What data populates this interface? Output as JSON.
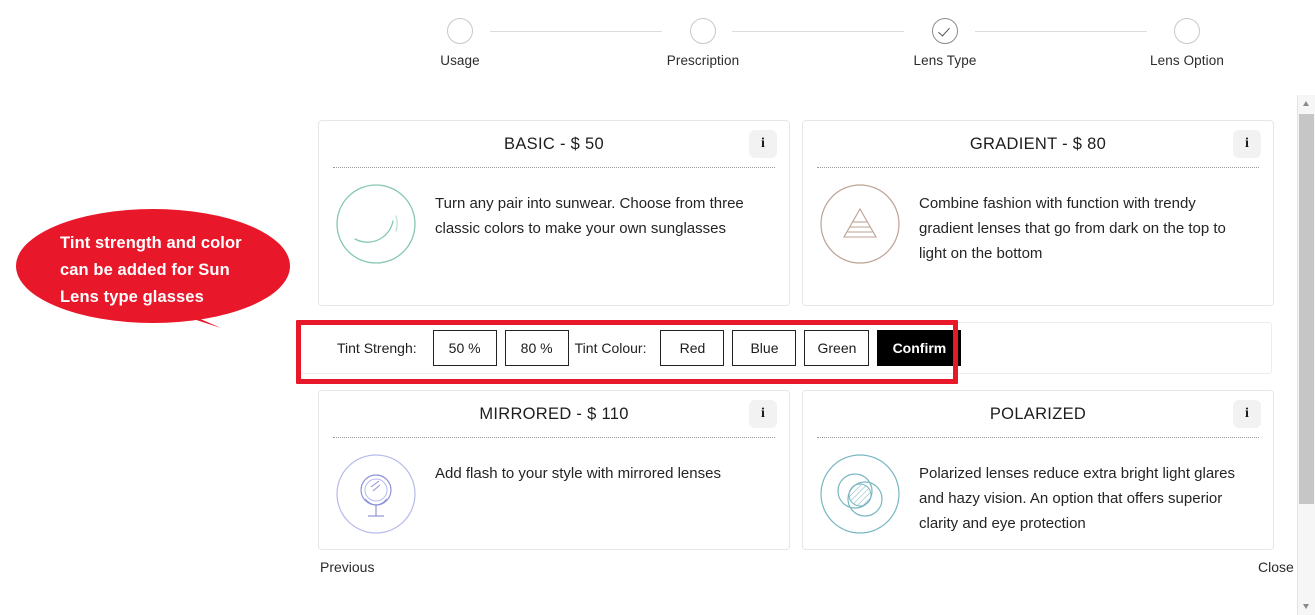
{
  "stepper": {
    "steps": [
      {
        "label": "Usage",
        "state": "pending"
      },
      {
        "label": "Prescription",
        "state": "pending"
      },
      {
        "label": "Lens Type",
        "state": "done"
      },
      {
        "label": "Lens Option",
        "state": "pending"
      }
    ]
  },
  "cards": [
    {
      "title": "BASIC - $ 50",
      "info_label": "i",
      "description": "Turn any pair into sunwear. Choose from three classic colors to make your own sunglasses",
      "icon": "tint-circle-icon",
      "icon_color": "#86c9ae"
    },
    {
      "title": "GRADIENT - $ 80",
      "info_label": "i",
      "description": "Combine fashion with function with trendy gradient lenses that go from dark on the top to light on the bottom",
      "icon": "gradient-trapezoid-icon",
      "icon_color": "#bda194"
    },
    {
      "title": "MIRRORED - $ 110",
      "info_label": "i",
      "description": "Add flash to your style with mirrored lenses",
      "icon": "hand-mirror-icon",
      "icon_color": "#b6bbea"
    },
    {
      "title": "POLARIZED",
      "info_label": "i",
      "description": "Polarized lenses reduce extra bright light glares and hazy vision. An option that offers superior clarity and eye protection",
      "icon": "overlapping-circles-icon",
      "icon_color": "#79b6c2"
    }
  ],
  "tint_bar": {
    "strength_label": "Tint Strengh:",
    "strength_options": [
      "50 %",
      "80 %"
    ],
    "colour_label": "Tint Colour:",
    "colour_options": [
      "Red",
      "Blue",
      "Green"
    ],
    "confirm_label": "Confirm",
    "highlight_color": "#e8182a"
  },
  "callout": {
    "text": "Tint strength and color can be added for Sun Lens type glasses",
    "bubble_color": "#e8182a",
    "text_color": "#ffffff"
  },
  "footer": {
    "previous_label": "Previous",
    "close_label": "Close"
  },
  "scrollbar": {
    "up_icon": "triangle-up-icon",
    "down_icon": "triangle-down-icon"
  }
}
